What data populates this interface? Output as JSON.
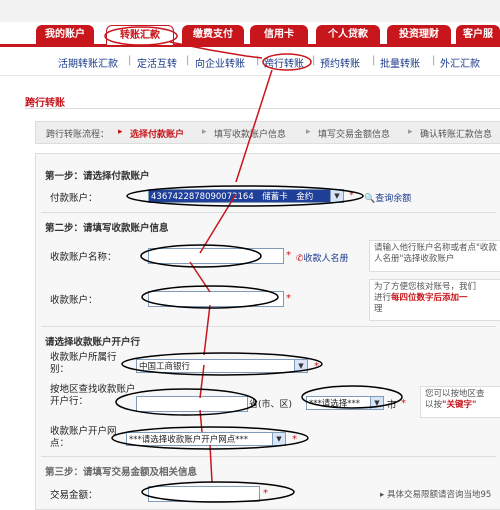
{
  "nav": {
    "tabs": [
      {
        "label": "我的账户"
      },
      {
        "label": "转账汇款"
      },
      {
        "label": "缴费支付"
      },
      {
        "label": "信用卡"
      },
      {
        "label": "个人贷款"
      },
      {
        "label": "投资理财"
      },
      {
        "label": "客户服"
      }
    ]
  },
  "subnav": {
    "links": [
      "活期转账汇款",
      "定活互转",
      "向企业转账",
      "跨行转账",
      "预约转账",
      "批量转账",
      "外汇汇款"
    ]
  },
  "page": {
    "title": "跨行转账",
    "flow_label": "跨行转账流程：",
    "flow_steps": [
      "选择付款账户",
      "填写收款账户信息",
      "填写交易金额信息",
      "确认转账汇款信息"
    ]
  },
  "step1": {
    "heading": "第一步：请选择付款账户",
    "payer_label": "付款账户：",
    "payer_value": "4367422878090072164　储蓄卡　金约",
    "balance_link": "查询余额"
  },
  "step2": {
    "heading": "第二步：请填写收款账户信息",
    "name_label": "收款账户名称：",
    "name_link": "收款人名册",
    "name_hint": "请输入他行账户名称或者点\"收款人名册\"选择收款账户",
    "account_label": "收款账户：",
    "account_hint_pre": "为了方便您核对账号，我们",
    "account_hint_mid": "进行",
    "account_hint_strong": "每四位数字后添加一",
    "account_hint_post": "理"
  },
  "bank": {
    "heading": "请选择收款账户开户行",
    "bank_label": "收款账户所属行别：",
    "bank_value": "中国工商银行",
    "region_label": "按地区查找收款账户开户行：",
    "city_suffix": "省(市、区)",
    "city_select": "***请选择***",
    "city_unit": "市",
    "region_hint": "您可以按地区查",
    "region_hint2_pre": "以按",
    "region_hint2_strong": "\"关键字\"",
    "branch_label": "收款账户开户网点：",
    "branch_value": "***请选择收款账户开户网点***"
  },
  "step3": {
    "heading": "第三步：请填写交易金额及相关信息",
    "amount_label": "交易金额：",
    "amount_note": "具体交易限额请咨询当地95"
  },
  "colors": {
    "brand_red": "#c8161d",
    "link_blue": "#1a3a8c",
    "highlight_blue": "#1f3f99"
  }
}
